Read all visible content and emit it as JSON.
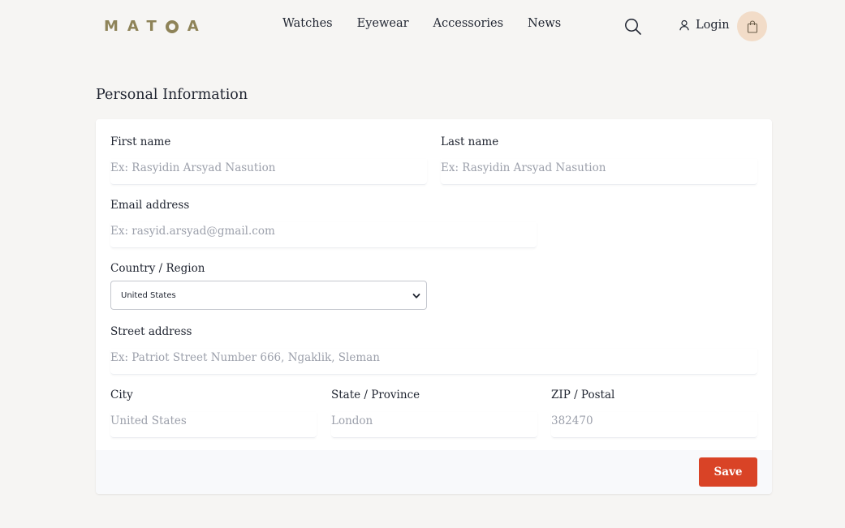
{
  "header": {
    "logo_text": "MATOA",
    "nav": [
      {
        "label": "Watches"
      },
      {
        "label": "Eyewear"
      },
      {
        "label": "Accessories"
      },
      {
        "label": "News"
      }
    ],
    "login_label": "Login",
    "icons": {
      "search": "search-icon",
      "user": "user-icon",
      "cart": "shopping-bag-icon"
    },
    "colors": {
      "logo": "#8e8358",
      "cart_bg": "#f2dcc8"
    }
  },
  "page": {
    "title": "Personal Information"
  },
  "form": {
    "first_name": {
      "label": "First name",
      "value": "",
      "placeholder": "Ex: Rasyidin Arsyad Nasution"
    },
    "last_name": {
      "label": "Last name",
      "value": "",
      "placeholder": "Ex: Rasyidin Arsyad Nasution"
    },
    "email": {
      "label": "Email address",
      "value": "",
      "placeholder": "Ex: rasyid.arsyad@gmail.com"
    },
    "country": {
      "label": "Country / Region",
      "selected": "United States"
    },
    "street": {
      "label": "Street address",
      "value": "",
      "placeholder": "Ex: Patriot Street Number 666, Ngaklik, Sleman"
    },
    "city": {
      "label": "City",
      "value": "",
      "placeholder": "United States"
    },
    "state": {
      "label": "State / Province",
      "value": "",
      "placeholder": "London"
    },
    "zip": {
      "label": "ZIP / Postal",
      "value": "",
      "placeholder": "382470"
    },
    "save_label": "Save",
    "colors": {
      "save_button": "#d94326"
    }
  }
}
